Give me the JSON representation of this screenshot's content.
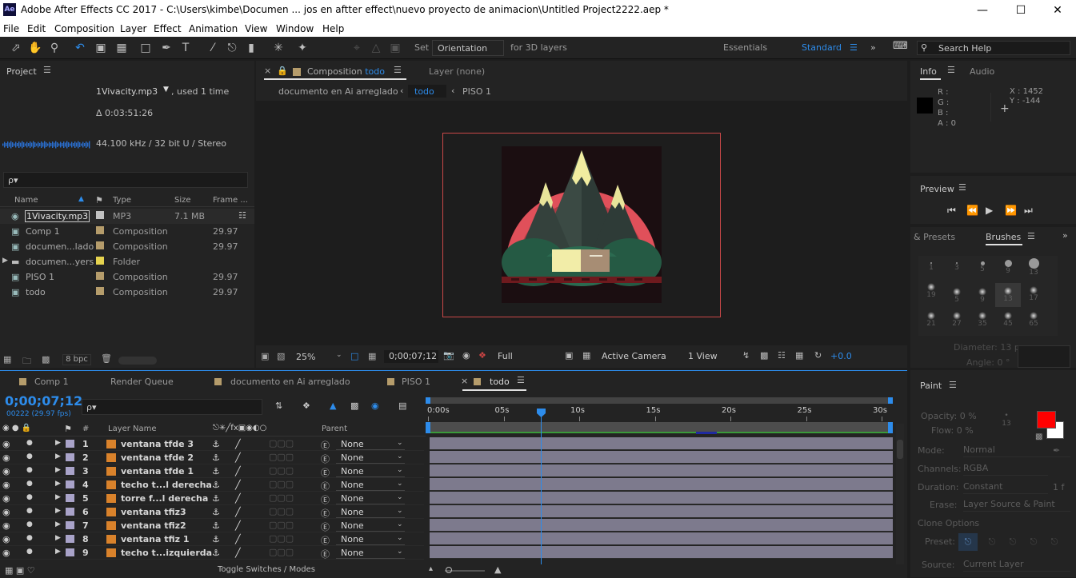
{
  "app": {
    "logo": "Ae",
    "title": "Adobe After Effects CC 2017 - C:\\Users\\kimbe\\Documen ... jos en aftter effect\\nuevo proyecto de animacion\\Untitled Project2222.aep *"
  },
  "menu": [
    "File",
    "Edit",
    "Composition",
    "Layer",
    "Effect",
    "Animation",
    "View",
    "Window",
    "Help"
  ],
  "toolbar": {
    "set_label": "Set",
    "orientation": "Orientation",
    "for3d": "for 3D layers",
    "workspaces": [
      "Essentials",
      "Standard"
    ],
    "search_placeholder": "Search Help"
  },
  "project": {
    "title": "Project",
    "selected_name": "1Vivacity.mp3",
    "used": ", used 1 time",
    "duration": "Δ 0:03:51:26",
    "audio_info": "44.100 kHz / 32 bit U / Stereo",
    "search_placeholder": "ρ▾",
    "columns": {
      "name": "Name",
      "type": "Type",
      "size": "Size",
      "frame": "Frame ..."
    },
    "items": [
      {
        "name": "1Vivacity.mp3",
        "type": "MP3",
        "size": "7.1 MB",
        "frame": "",
        "color": "#c2c2c2",
        "icon": "audio-file-icon"
      },
      {
        "name": "Comp 1",
        "type": "Composition",
        "size": "",
        "frame": "29.97",
        "color": "#b59c6b",
        "icon": "composition-icon"
      },
      {
        "name": "documen...lado",
        "type": "Composition",
        "size": "",
        "frame": "29.97",
        "color": "#b59c6b",
        "icon": "composition-icon"
      },
      {
        "name": "documen...yers",
        "type": "Folder",
        "size": "",
        "frame": "",
        "color": "#e6d34f",
        "icon": "folder-icon"
      },
      {
        "name": "PISO 1",
        "type": "Composition",
        "size": "",
        "frame": "29.97",
        "color": "#b59c6b",
        "icon": "composition-icon"
      },
      {
        "name": "todo",
        "type": "Composition",
        "size": "",
        "frame": "29.97",
        "color": "#b59c6b",
        "icon": "composition-icon"
      }
    ],
    "bpc": "8 bpc"
  },
  "viewer": {
    "comp_tab": "Composition",
    "comp_name": "todo",
    "layer_tab": "Layer (none)",
    "breadcrumbs": [
      "documento en Ai arreglado",
      "todo",
      "PISO 1"
    ],
    "zoom": "25%",
    "timecode": "0;00;07;12",
    "resolution": "Full",
    "camera": "Active Camera",
    "views": "1 View",
    "exposure": "+0.0"
  },
  "info": {
    "tabs": [
      "Info",
      "Audio"
    ],
    "r": "R :",
    "g": "G :",
    "b": "B :",
    "a": "A : 0",
    "x": "X : 1452",
    "y": "Y : -144"
  },
  "preview": {
    "title": "Preview"
  },
  "brushes": {
    "tabs": [
      "& Presets",
      "Brushes"
    ],
    "sizes": [
      "1",
      "3",
      "5",
      "9",
      "13",
      "19",
      "5",
      "9",
      "13",
      "17",
      "21",
      "27",
      "35",
      "45",
      "65"
    ],
    "diameter": "Diameter: 13 px",
    "angle": "Angle: 0 °"
  },
  "paint": {
    "title": "Paint",
    "opacity": "Opacity: 0 %",
    "flow": "Flow: 0 %",
    "brush_size": "13",
    "mode_label": "Mode:",
    "mode_value": "Normal",
    "channels_label": "Channels:",
    "channels_value": "RGBA",
    "duration_label": "Duration:",
    "duration_value": "Constant",
    "duration_extra": "1  f",
    "erase_label": "Erase:",
    "erase_value": "Layer Source & Paint",
    "clone_options": "Clone Options",
    "preset_label": "Preset:",
    "source_label": "Source:",
    "source_value": "Current Layer",
    "fg_color": "#ff0000",
    "bg_color": "#ffffff"
  },
  "timeline": {
    "tabs": [
      "Comp 1",
      "Render Queue",
      "documento en Ai arreglado",
      "PISO 1",
      "todo"
    ],
    "timecode": "0;00;07;12",
    "frame_info": "00222 (29.97 fps)",
    "search_placeholder": "ρ▾",
    "col_layer_name": "Layer Name",
    "col_hash": "#",
    "col_parent": "Parent",
    "ruler": [
      "0:00s",
      "05s",
      "10s",
      "15s",
      "20s",
      "25s",
      "30s"
    ],
    "layers": [
      {
        "num": "1",
        "name": "ventana tfde 3",
        "parent": "None"
      },
      {
        "num": "2",
        "name": "ventana tfde 2",
        "parent": "None"
      },
      {
        "num": "3",
        "name": "ventana tfde 1",
        "parent": "None"
      },
      {
        "num": "4",
        "name": "techo t...l derecha",
        "parent": "None"
      },
      {
        "num": "5",
        "name": "torre f...l derecha",
        "parent": "None"
      },
      {
        "num": "6",
        "name": "ventana tfiz3",
        "parent": "None"
      },
      {
        "num": "7",
        "name": "ventana tfiz2",
        "parent": "None"
      },
      {
        "num": "8",
        "name": "ventana tfiz 1",
        "parent": "None"
      },
      {
        "num": "9",
        "name": "techo t...izquierda",
        "parent": "None"
      }
    ],
    "toggle_label": "Toggle Switches / Modes"
  }
}
